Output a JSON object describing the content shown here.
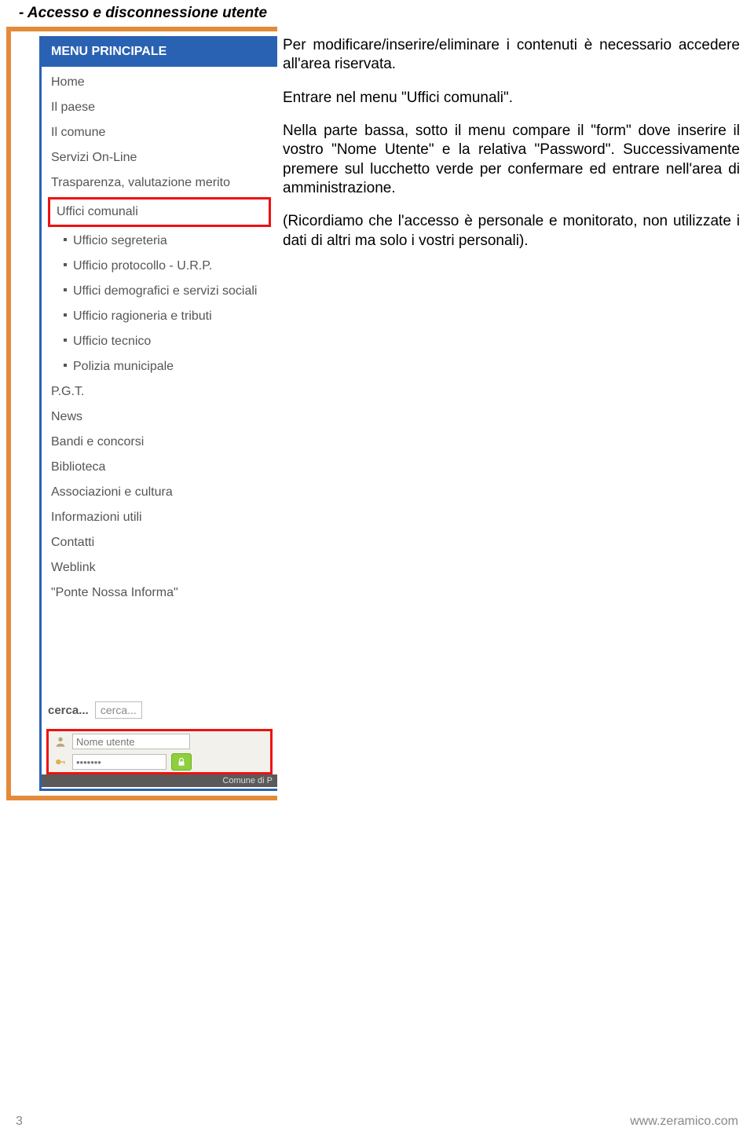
{
  "heading_prefix": "- ",
  "heading": "Accesso e disconnessione utente",
  "menu_header": "MENU PRINCIPALE",
  "menu": {
    "items": [
      {
        "label": "Home"
      },
      {
        "label": "Il paese"
      },
      {
        "label": "Il comune"
      },
      {
        "label": "Servizi On-Line"
      },
      {
        "label": "Trasparenza, valutazione merito"
      },
      {
        "label": "Uffici comunali",
        "highlight": true
      },
      {
        "label": "Ufficio segreteria",
        "sub": true
      },
      {
        "label": "Ufficio protocollo - U.R.P.",
        "sub": true
      },
      {
        "label": "Uffici demografici e servizi sociali",
        "sub": true
      },
      {
        "label": "Ufficio ragioneria e tributi",
        "sub": true
      },
      {
        "label": "Ufficio tecnico",
        "sub": true
      },
      {
        "label": "Polizia municipale",
        "sub": true
      },
      {
        "label": "P.G.T."
      },
      {
        "label": "News"
      },
      {
        "label": "Bandi e concorsi"
      },
      {
        "label": "Biblioteca"
      },
      {
        "label": "Associazioni e cultura"
      },
      {
        "label": "Informazioni utili"
      },
      {
        "label": "Contatti"
      },
      {
        "label": "Weblink"
      },
      {
        "label": "\"Ponte Nossa Informa\""
      }
    ]
  },
  "search": {
    "label": "cerca...",
    "placeholder": "cerca..."
  },
  "login": {
    "username_placeholder": "Nome utente",
    "password_masked": "•••••••"
  },
  "footer_strip": "Comune di P",
  "body": {
    "p1": "Per modificare/inserire/eliminare i contenuti è necessario accedere all'area riservata.",
    "p2": "Entrare nel menu \"Uffici comunali\".",
    "p3": "Nella parte bassa, sotto il menu compare il \"form\" dove inserire il vostro \"Nome Utente\" e la relativa \"Password\". Successivamente premere sul lucchetto verde per confermare ed entrare nell'area di amministrazione.",
    "p4": "(Ricordiamo che l'accesso è personale e monitorato, non utilizzate i dati di altri ma solo i vostri personali)."
  },
  "page_number": "3",
  "site_url": "www.zeramico.com"
}
